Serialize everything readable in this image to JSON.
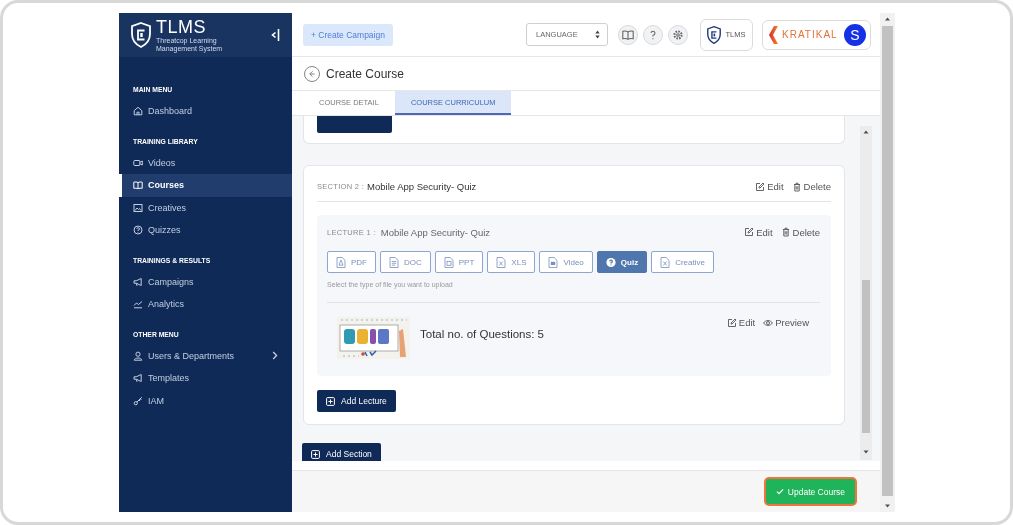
{
  "sidebar": {
    "brand": {
      "name": "TLMS",
      "tagline": "Threatcop Learning Management System"
    },
    "groups": [
      {
        "heading": "MAIN MENU",
        "items": [
          {
            "label": "Dashboard",
            "kind": "home",
            "selected": false,
            "submenu": false
          }
        ]
      },
      {
        "heading": "TRAINING LIBRARY",
        "items": [
          {
            "label": "Videos",
            "kind": "video",
            "selected": false,
            "submenu": false
          },
          {
            "label": "Courses",
            "kind": "book",
            "selected": true,
            "submenu": false
          },
          {
            "label": "Creatives",
            "kind": "image",
            "selected": false,
            "submenu": false
          },
          {
            "label": "Quizzes",
            "kind": "help",
            "selected": false,
            "submenu": false
          }
        ]
      },
      {
        "heading": "TRAININGS & RESULTS",
        "items": [
          {
            "label": "Campaigns",
            "kind": "megaphone",
            "selected": false,
            "submenu": false
          },
          {
            "label": "Analytics",
            "kind": "chart",
            "selected": false,
            "submenu": false
          }
        ]
      },
      {
        "heading": "OTHER MENU",
        "items": [
          {
            "label": "Users & Departments",
            "kind": "user",
            "selected": false,
            "submenu": true
          },
          {
            "label": "Templates",
            "kind": "megaphone",
            "selected": false,
            "submenu": false
          },
          {
            "label": "IAM",
            "kind": "key",
            "selected": false,
            "submenu": false
          }
        ]
      }
    ]
  },
  "topbar": {
    "create_button": "+ Create Campaign",
    "language_select": {
      "value": "LANGUAGE"
    },
    "product_badge": "TLMS",
    "company_logo": "KRATIKAL",
    "avatar": "S"
  },
  "page": {
    "title": "Create Course",
    "tabs": [
      {
        "label": "COURSE DETAIL",
        "selected": false
      },
      {
        "label": "COURSE CURRICULUM",
        "selected": true
      }
    ]
  },
  "sections": [
    {
      "label": "SECTION 2 :",
      "title": "Mobile App Security- Quiz",
      "actions": [
        {
          "label": "Edit",
          "kind": "edit"
        },
        {
          "label": "Delete",
          "kind": "delete"
        }
      ],
      "lectures": [
        {
          "label": "LECTURE 1 :",
          "title": "Mobile App Security- Quiz",
          "actions": [
            {
              "label": "Edit",
              "kind": "edit"
            },
            {
              "label": "Delete",
              "kind": "delete"
            }
          ],
          "file_types": [
            {
              "label": "PDF",
              "kind": "pdf",
              "selected": false
            },
            {
              "label": "DOC",
              "kind": "doc",
              "selected": false
            },
            {
              "label": "PPT",
              "kind": "ppt",
              "selected": false
            },
            {
              "label": "XLS",
              "kind": "xls",
              "selected": false
            },
            {
              "label": "Video",
              "kind": "video",
              "selected": false
            },
            {
              "label": "Quiz",
              "kind": "quiz",
              "selected": true
            },
            {
              "label": "Creative",
              "kind": "creative",
              "selected": false
            }
          ],
          "hint": "Select the type of file you want to upload",
          "content": {
            "summary": "Total no. of Questions: 5",
            "actions": [
              {
                "label": "Edit",
                "kind": "edit"
              },
              {
                "label": "Preview",
                "kind": "preview"
              }
            ]
          }
        }
      ],
      "add_lecture": "Add Lecture"
    }
  ],
  "add_section": "Add Section",
  "footer": {
    "submit": "Update Course"
  }
}
